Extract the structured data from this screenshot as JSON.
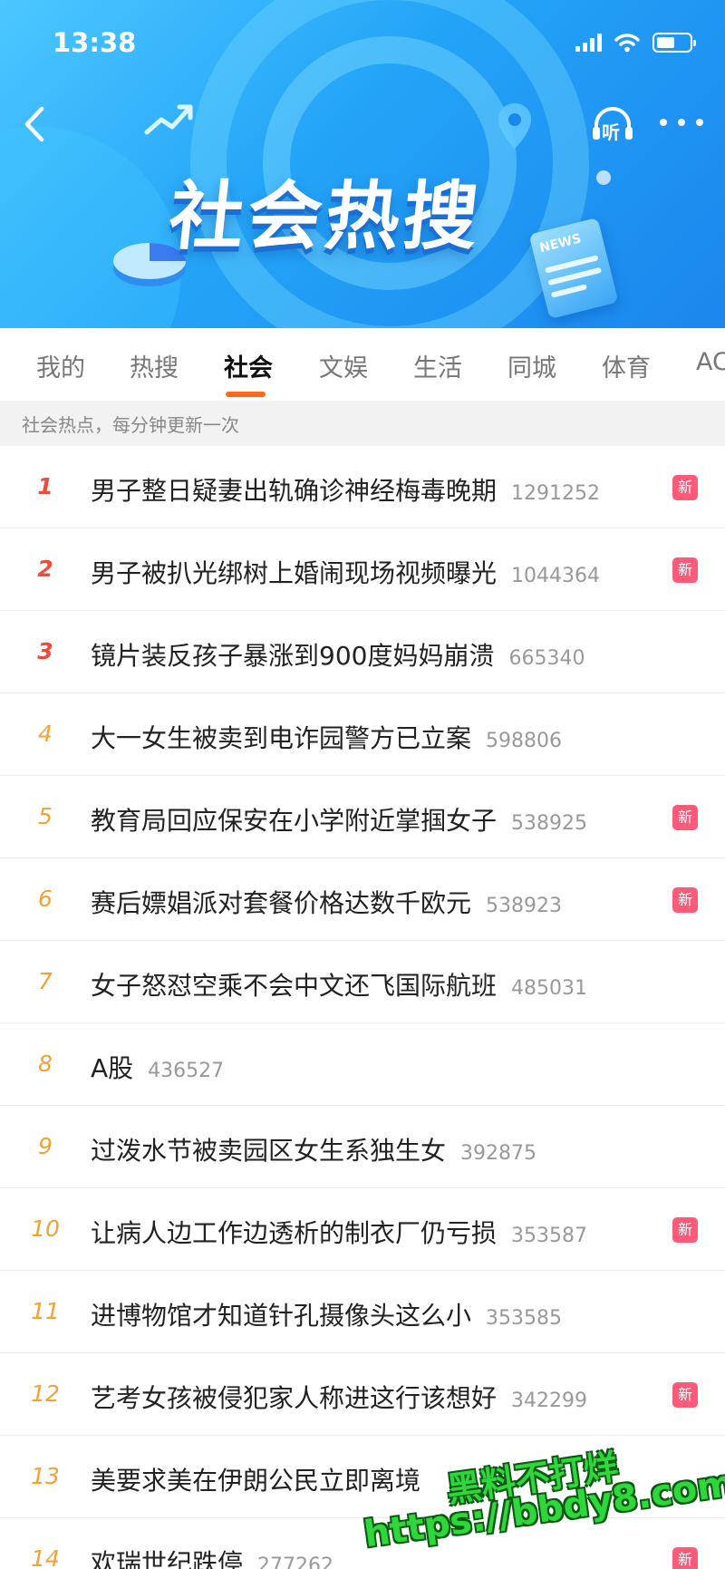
{
  "status_bar": {
    "time": "13:38"
  },
  "header": {
    "title": "社会热搜",
    "listen_label": "听",
    "news_label": "NEWS"
  },
  "tabs": [
    {
      "label": "我的",
      "active": false
    },
    {
      "label": "热搜",
      "active": false
    },
    {
      "label": "社会",
      "active": true
    },
    {
      "label": "文娱",
      "active": false
    },
    {
      "label": "生活",
      "active": false
    },
    {
      "label": "同城",
      "active": false
    },
    {
      "label": "体育",
      "active": false
    },
    {
      "label": "AC",
      "active": false
    }
  ],
  "subtitle": "社会热点，每分钟更新一次",
  "new_badge_label": "新",
  "items": [
    {
      "rank": "1",
      "title": "男子整日疑妻出轨确诊神经梅毒晚期",
      "count": "1291252",
      "is_new": true
    },
    {
      "rank": "2",
      "title": "男子被扒光绑树上婚闹现场视频曝光",
      "count": "1044364",
      "is_new": true
    },
    {
      "rank": "3",
      "title": "镜片装反孩子暴涨到900度妈妈崩溃",
      "count": "665340",
      "is_new": false
    },
    {
      "rank": "4",
      "title": "大一女生被卖到电诈园警方已立案",
      "count": "598806",
      "is_new": false
    },
    {
      "rank": "5",
      "title": "教育局回应保安在小学附近掌掴女子",
      "count": "538925",
      "is_new": true
    },
    {
      "rank": "6",
      "title": "赛后嫖娼派对套餐价格达数千欧元",
      "count": "538923",
      "is_new": true
    },
    {
      "rank": "7",
      "title": "女子怒怼空乘不会中文还飞国际航班",
      "count": "485031",
      "is_new": false
    },
    {
      "rank": "8",
      "title": "A股",
      "count": "436527",
      "is_new": false
    },
    {
      "rank": "9",
      "title": "过泼水节被卖园区女生系独生女",
      "count": "392875",
      "is_new": false
    },
    {
      "rank": "10",
      "title": "让病人边工作边透析的制衣厂仍亏损",
      "count": "353587",
      "is_new": true
    },
    {
      "rank": "11",
      "title": "进博物馆才知道针孔摄像头这么小",
      "count": "353585",
      "is_new": false
    },
    {
      "rank": "12",
      "title": "艺考女孩被侵犯家人称进这行该想好",
      "count": "342299",
      "is_new": true
    },
    {
      "rank": "13",
      "title": "美要求美在伊朗公民立即离境",
      "count": "",
      "is_new": false
    },
    {
      "rank": "14",
      "title": "欢瑞世纪跌停",
      "count": "277262",
      "is_new": true
    }
  ],
  "watermark": {
    "line1": "黑料不打烊",
    "line2": "https://bbdy8.com"
  },
  "colors": {
    "accent": "#ff6a1a",
    "rank_hot": "#f24a3c",
    "rank_warm": "#f3a233",
    "badge": "#ff5a7a",
    "banner": "#23a3f7"
  }
}
